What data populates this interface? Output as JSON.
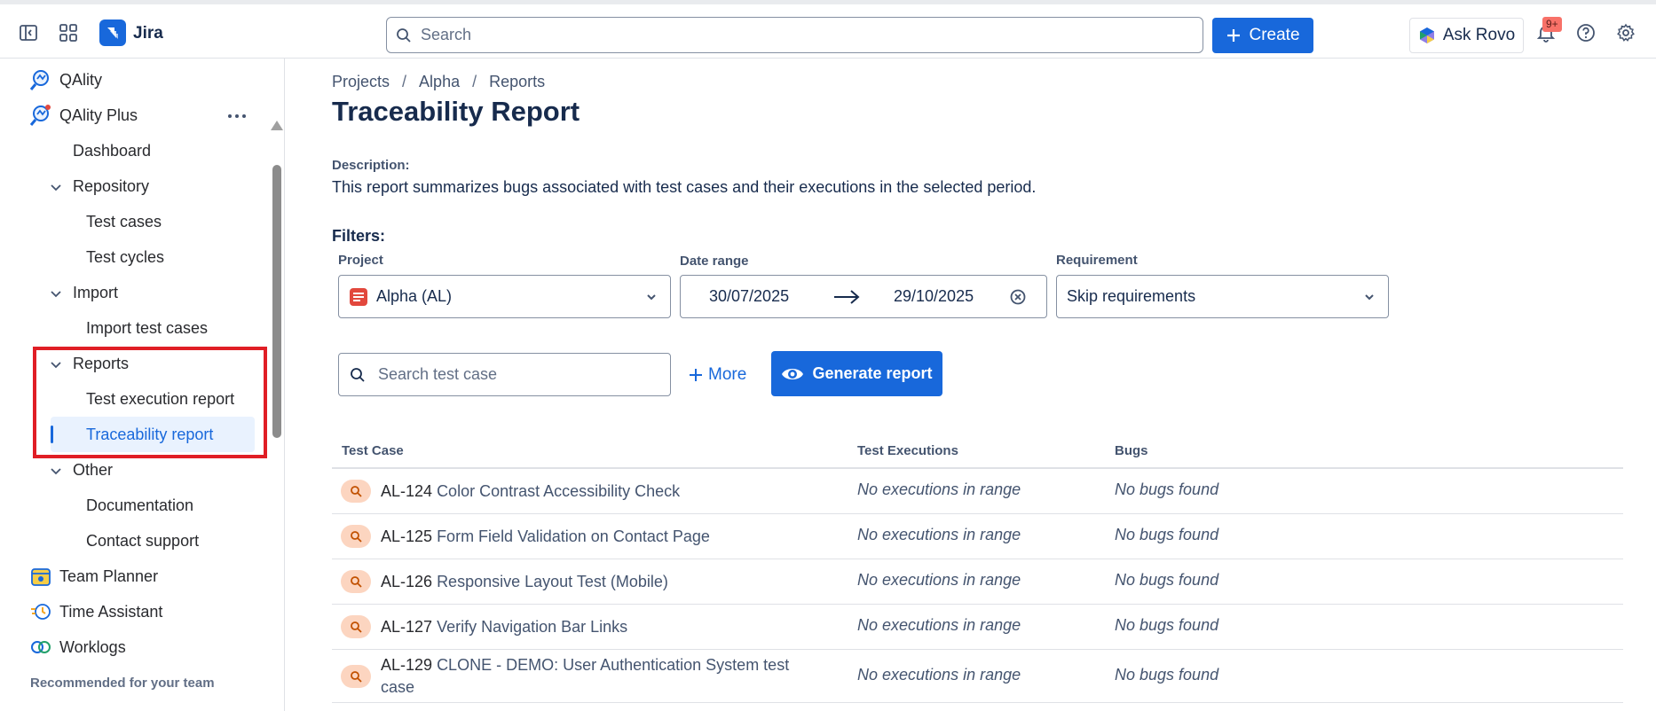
{
  "topbar": {
    "app_name": "Jira",
    "search_placeholder": "Search",
    "create_label": "Create",
    "ask_rovo_label": "Ask Rovo",
    "notifications_badge": "9+"
  },
  "sidebar": {
    "apps": [
      {
        "label": "QAlity"
      },
      {
        "label": "QAlity Plus"
      }
    ],
    "items": {
      "dashboard": "Dashboard",
      "repository": "Repository",
      "test_cases": "Test cases",
      "test_cycles": "Test cycles",
      "import": "Import",
      "import_test_cases": "Import test cases",
      "reports": "Reports",
      "test_execution_report": "Test execution report",
      "traceability_report": "Traceability report",
      "other": "Other",
      "documentation": "Documentation",
      "contact_support": "Contact support"
    },
    "more_apps": [
      {
        "label": "Team Planner"
      },
      {
        "label": "Time Assistant"
      },
      {
        "label": "Worklogs"
      }
    ],
    "recommended_heading": "Recommended for your team"
  },
  "breadcrumb": [
    "Projects",
    "Alpha",
    "Reports"
  ],
  "page_title": "Traceability Report",
  "description": {
    "label": "Description:",
    "text": "This report summarizes bugs associated with test cases and their executions in the selected period."
  },
  "filters": {
    "label": "Filters:",
    "project": {
      "label": "Project",
      "value": "Alpha (AL)"
    },
    "date_range": {
      "label": "Date range",
      "start": "30/07/2025",
      "end": "29/10/2025"
    },
    "requirement": {
      "label": "Requirement",
      "value": "Skip requirements"
    }
  },
  "actions": {
    "search_placeholder": "Search test case",
    "more_label": "More",
    "generate_label": "Generate report"
  },
  "table": {
    "columns": [
      "Test Case",
      "Test Executions",
      "Bugs"
    ],
    "rows": [
      {
        "key": "AL-124",
        "title": "Color Contrast Accessibility Check",
        "executions": "No executions in range",
        "bugs": "No bugs found"
      },
      {
        "key": "AL-125",
        "title": "Form Field Validation on Contact Page",
        "executions": "No executions in range",
        "bugs": "No bugs found"
      },
      {
        "key": "AL-126",
        "title": "Responsive Layout Test (Mobile)",
        "executions": "No executions in range",
        "bugs": "No bugs found"
      },
      {
        "key": "AL-127",
        "title": "Verify Navigation Bar Links",
        "executions": "No executions in range",
        "bugs": "No bugs found"
      },
      {
        "key": "AL-129",
        "title": "CLONE - DEMO: User Authentication System test case",
        "executions": "No executions in range",
        "bugs": "No bugs found"
      }
    ]
  },
  "colors": {
    "accent": "#1868db",
    "highlight_box": "#e01e25",
    "active_item_bg": "#e9f2fe"
  }
}
